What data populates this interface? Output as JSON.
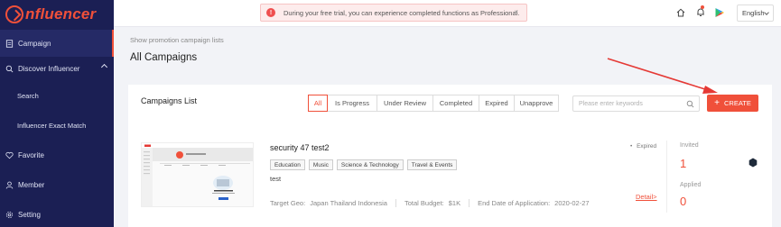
{
  "app": {
    "logo_text": "nfluencer"
  },
  "sidebar": {
    "items": [
      {
        "label": "Campaign",
        "icon": "document-icon",
        "active": true
      },
      {
        "label": "Discover Influencer",
        "icon": "search-icon",
        "expanded": true
      },
      {
        "label": "Search",
        "sub": true
      },
      {
        "label": "Influencer Exact Match",
        "sub": true
      },
      {
        "label": "Favorite",
        "icon": "heart-icon"
      },
      {
        "label": "Member",
        "icon": "user-icon"
      },
      {
        "label": "Setting",
        "icon": "gear-icon"
      }
    ]
  },
  "topbar": {
    "notice": "During your free trial, you can experience completed functions as Professional.",
    "notice_close": "×",
    "language": "English"
  },
  "page": {
    "breadcrumb": "Show promotion campaign lists",
    "title": "All Campaigns"
  },
  "campaigns_panel": {
    "title": "Campaigns List",
    "tabs": [
      "All",
      "Is Progress",
      "Under Review",
      "Completed",
      "Expired",
      "Unapprove"
    ],
    "active_tab": "All",
    "search_placeholder": "Please enter keywords",
    "create_label": "CREATE",
    "create_plus": "+"
  },
  "campaign": {
    "title": "security 47 test2",
    "tags": [
      "Education",
      "Music",
      "Science & Technology",
      "Travel & Events"
    ],
    "description": "test",
    "status": "Expired",
    "status_dot": "•",
    "target_geo_label": "Target Geo:",
    "target_geo": "Japan  Thailand  Indonesia",
    "budget_label": "Total Budget:",
    "budget": "$1K",
    "end_label": "End Date of Application:",
    "end_date": "2020-02-27",
    "detail_label": "Detail>",
    "invited_label": "Invited",
    "invited_value": "1",
    "applied_label": "Applied",
    "applied_value": "0"
  },
  "colors": {
    "accent": "#f0503a",
    "sidebar": "#1b1f54"
  }
}
